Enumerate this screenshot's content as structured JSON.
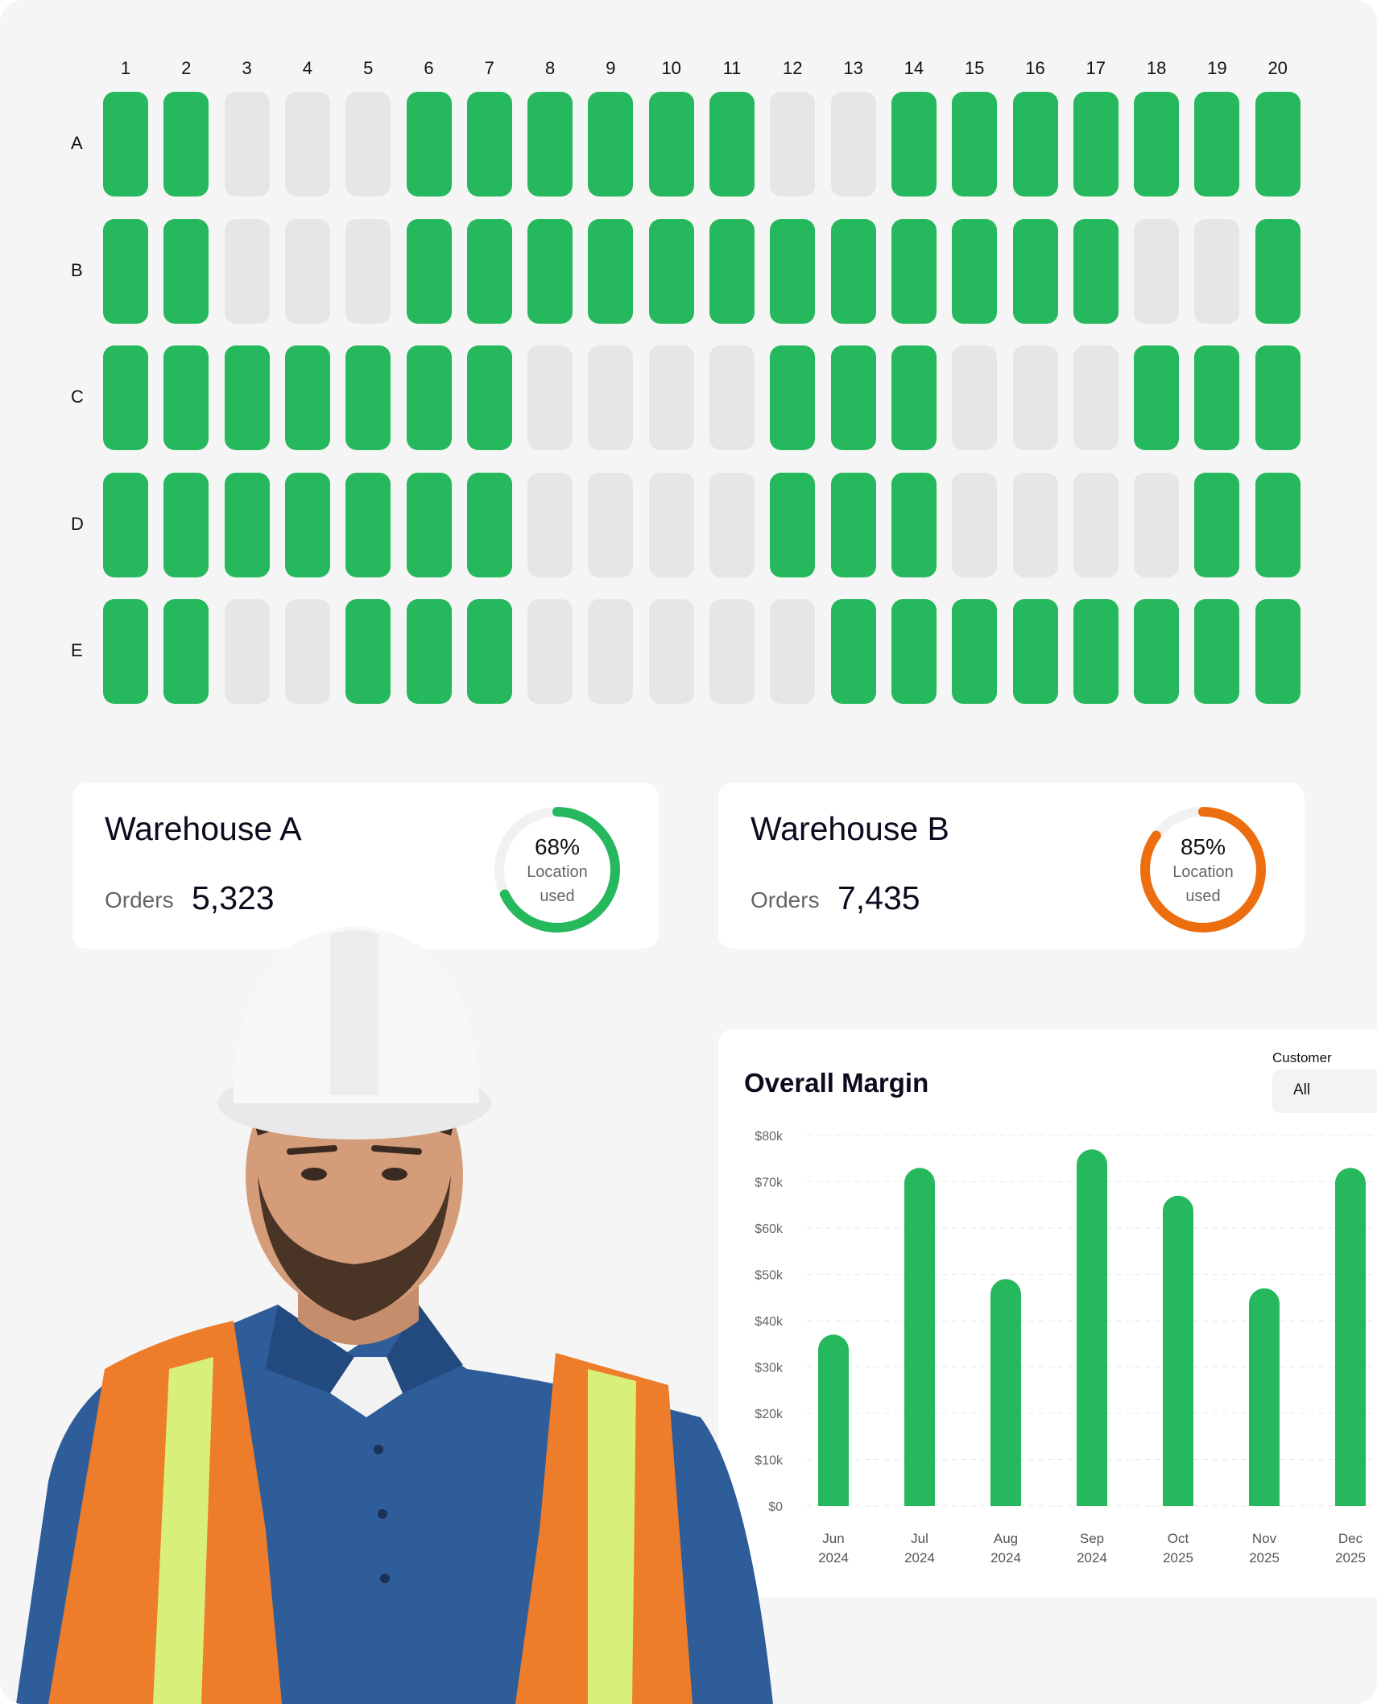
{
  "grid": {
    "columns": [
      "1",
      "2",
      "3",
      "4",
      "5",
      "6",
      "7",
      "8",
      "9",
      "10",
      "11",
      "12",
      "13",
      "14",
      "15",
      "16",
      "17",
      "18",
      "19",
      "20"
    ],
    "rows": [
      {
        "label": "A",
        "cells": [
          1,
          1,
          0,
          0,
          0,
          1,
          1,
          1,
          1,
          1,
          1,
          0,
          0,
          1,
          1,
          1,
          1,
          1,
          1,
          1
        ]
      },
      {
        "label": "B",
        "cells": [
          1,
          1,
          0,
          0,
          0,
          1,
          1,
          1,
          1,
          1,
          1,
          1,
          1,
          1,
          1,
          1,
          1,
          0,
          0,
          1
        ]
      },
      {
        "label": "C",
        "cells": [
          1,
          1,
          1,
          1,
          1,
          1,
          1,
          0,
          0,
          0,
          0,
          1,
          1,
          1,
          0,
          0,
          0,
          1,
          1,
          1
        ]
      },
      {
        "label": "D",
        "cells": [
          1,
          1,
          1,
          1,
          1,
          1,
          1,
          0,
          0,
          0,
          0,
          1,
          1,
          1,
          0,
          0,
          0,
          0,
          1,
          1
        ]
      },
      {
        "label": "E",
        "cells": [
          1,
          1,
          0,
          0,
          1,
          1,
          1,
          0,
          0,
          0,
          0,
          0,
          1,
          1,
          1,
          1,
          1,
          1,
          1,
          1
        ]
      }
    ],
    "colors": {
      "occupied": "#26b85c",
      "empty": "#e6e6e6"
    }
  },
  "warehouses": [
    {
      "title": "Warehouse A",
      "orders_label": "Orders",
      "orders_value": "5,323",
      "percent_text": "68%",
      "percent_value": 68,
      "sub_line1": "Location",
      "sub_line2": "used",
      "color": "#26b85c"
    },
    {
      "title": "Warehouse B",
      "orders_label": "Orders",
      "orders_value": "7,435",
      "percent_text": "85%",
      "percent_value": 85,
      "sub_line1": "Location",
      "sub_line2": "used",
      "color": "#ec6e0f"
    }
  ],
  "margin": {
    "title": "Overall Margin",
    "customer_label": "Customer",
    "customer_value": "All"
  },
  "chart_data": {
    "type": "bar",
    "title": "Overall Margin",
    "categories": [
      [
        "Jun",
        "2024"
      ],
      [
        "Jul",
        "2024"
      ],
      [
        "Aug",
        "2024"
      ],
      [
        "Sep",
        "2024"
      ],
      [
        "Oct",
        "2025"
      ],
      [
        "Nov",
        "2025"
      ],
      [
        "Dec",
        "2025"
      ]
    ],
    "values": [
      37000,
      73000,
      49000,
      77000,
      67000,
      47000,
      73000
    ],
    "yticks": [
      "$0",
      "$10k",
      "$20k",
      "$30k",
      "$40k",
      "$50k",
      "$60k",
      "$70k",
      "$80k"
    ],
    "ylim": [
      0,
      80000
    ],
    "grid": true,
    "bar_color": "#26b85c"
  }
}
